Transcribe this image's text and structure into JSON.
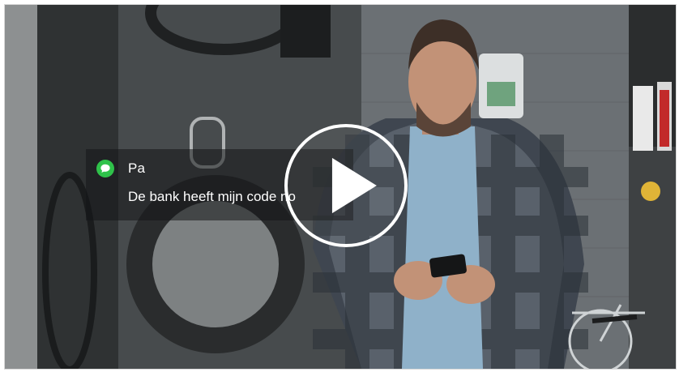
{
  "video": {
    "notification": {
      "app_icon": "message-bubble-icon",
      "sender": "Pa",
      "message": "De bank heeft mijn code no"
    },
    "play_icon": "play-icon",
    "colors": {
      "notification_icon": "#2fc24a",
      "play_button": "#ffffff"
    }
  }
}
